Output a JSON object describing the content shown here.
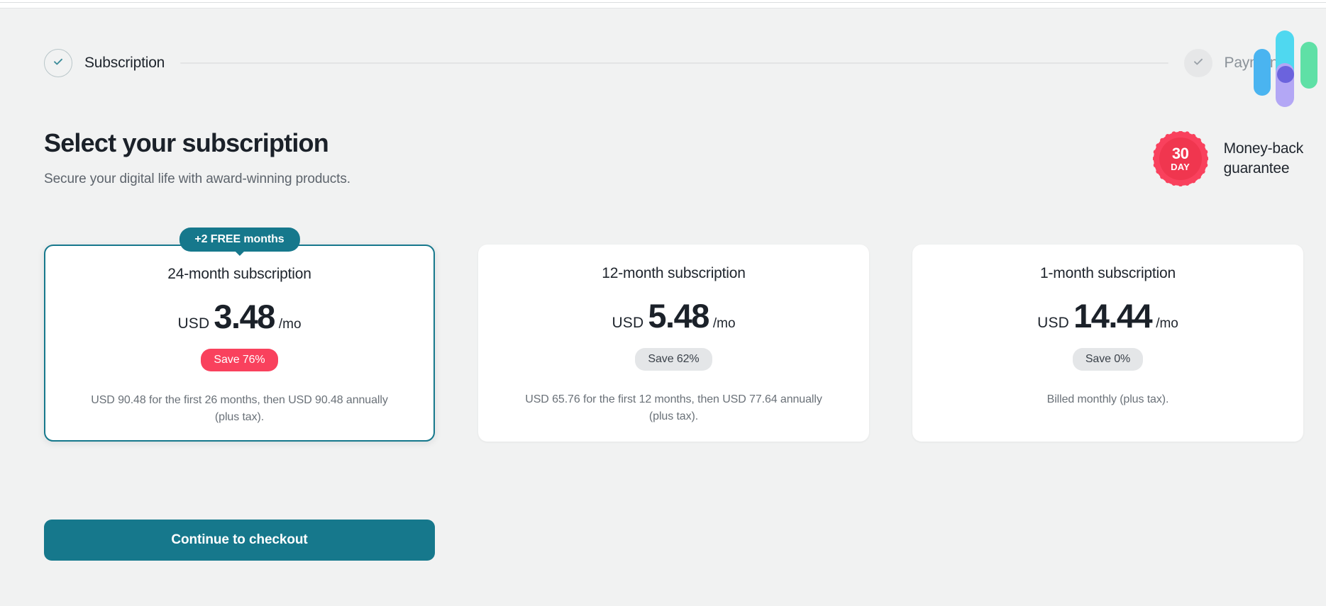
{
  "stepper": {
    "steps": [
      {
        "label": "Subscription",
        "state": "done",
        "icon": "check-icon"
      },
      {
        "label": "Payment",
        "state": "pending",
        "icon": "check-icon"
      }
    ]
  },
  "decoration": {
    "name": "decorative-bars-graphic",
    "colors": {
      "blue": "#4ab4f0",
      "cyan": "#4fd8f0",
      "purple": "#b3a7f5",
      "dot": "#6b63dd",
      "green": "#5fe0a6"
    }
  },
  "header": {
    "title": "Select your subscription",
    "subtitle": "Secure your digital life with award-winning products."
  },
  "guarantee": {
    "seal_number": "30",
    "seal_unit": "DAY",
    "line1": "Money-back",
    "line2": "guarantee",
    "seal_color": "#f9415d"
  },
  "plans": [
    {
      "badge": "+2 FREE months",
      "name": "24-month subscription",
      "currency": "USD",
      "amount": "3.48",
      "per": "/mo",
      "save": "Save 76%",
      "save_style": "hot",
      "fineprint": "USD 90.48 for the first 26 months, then USD 90.48 annually (plus tax).",
      "selected": true
    },
    {
      "badge": "",
      "name": "12-month subscription",
      "currency": "USD",
      "amount": "5.48",
      "per": "/mo",
      "save": "Save 62%",
      "save_style": "neutral",
      "fineprint": "USD 65.76 for the first 12 months, then USD 77.64 annually (plus tax).",
      "selected": false
    },
    {
      "badge": "",
      "name": "1-month subscription",
      "currency": "USD",
      "amount": "14.44",
      "per": "/mo",
      "save": "Save 0%",
      "save_style": "neutral",
      "fineprint": "Billed monthly (plus tax).",
      "selected": false
    }
  ],
  "cta": {
    "label": "Continue to checkout",
    "color": "#16788c"
  }
}
